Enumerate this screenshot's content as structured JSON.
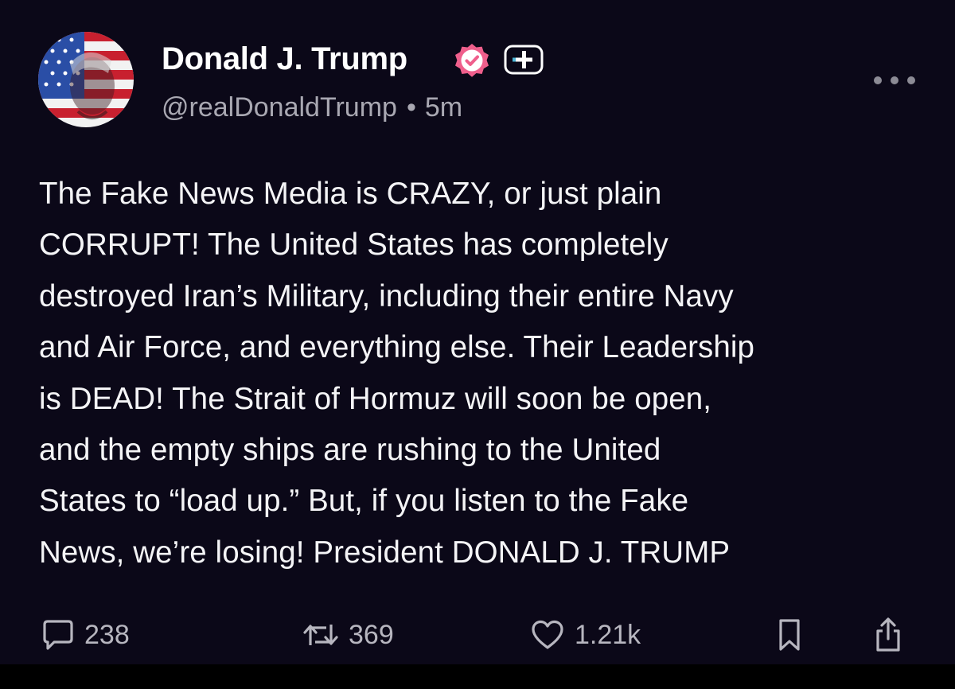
{
  "author": {
    "display_name": "Donald J. Trump",
    "handle": "@realDonaldTrump",
    "separator": "•",
    "timestamp": "5m",
    "verified": true,
    "verified_badge_color": "#ef5f8c",
    "plus_badge_icon": "plus-square-icon"
  },
  "post": {
    "text": "The Fake News Media is CRAZY, or just plain\nCORRUPT! The United States has completely\ndestroyed Iran’s Military, including their entire Navy\nand Air Force, and everything else. Their Leadership\nis DEAD! The Strait of Hormuz will soon be open,\nand the empty ships are rushing to the United\nStates to “load up.” But, if you listen to the Fake\nNews, we’re losing! President DONALD J. TRUMP"
  },
  "actions": {
    "reply": {
      "icon": "reply-bubble-icon",
      "count": "238"
    },
    "retruth": {
      "icon": "retruth-icon",
      "count": "369"
    },
    "like": {
      "icon": "heart-icon",
      "count": "1.21k"
    },
    "bookmark": {
      "icon": "bookmark-icon"
    },
    "share": {
      "icon": "share-icon"
    }
  },
  "colors": {
    "background": "#0b0818",
    "text": "#f4f4f6",
    "muted": "#a9a8b2"
  }
}
